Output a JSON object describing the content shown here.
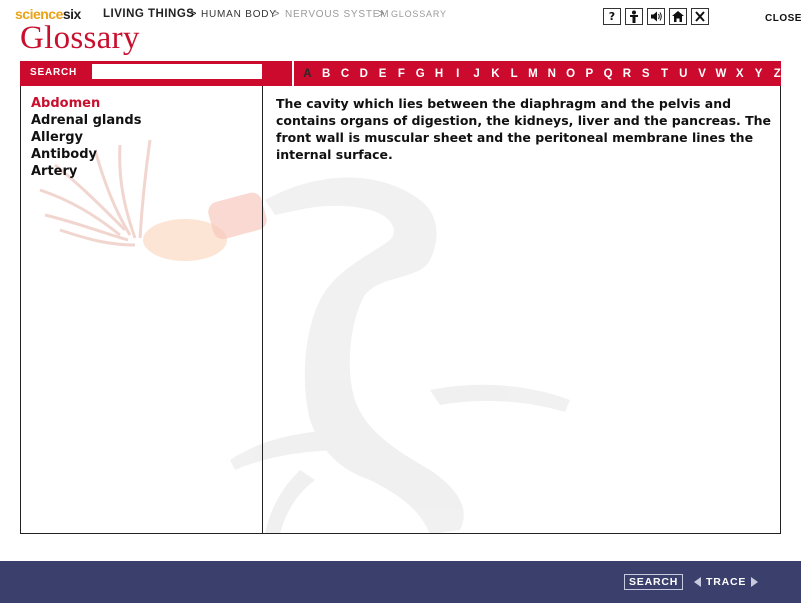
{
  "header": {
    "logo_part1": "science",
    "logo_part2": "six",
    "breadcrumb": {
      "level1": "LIVING THINGS",
      "sep1": ">",
      "level2": "HUMAN BODY",
      "sep2": ">",
      "level3": "NERVOUS SYSTEM",
      "sep3": ">",
      "level4": "GLOSSARY"
    },
    "icons": {
      "help": "?",
      "person": "person-icon",
      "sound": "speaker-icon",
      "home": "home-icon",
      "exit": "close-icon"
    },
    "close_label": "CLOSE"
  },
  "page_title": "Glossary",
  "search": {
    "label": "SEARCH",
    "value": "",
    "placeholder": ""
  },
  "alphabet": {
    "letters": [
      "A",
      "B",
      "C",
      "D",
      "E",
      "F",
      "G",
      "H",
      "I",
      "J",
      "K",
      "L",
      "M",
      "N",
      "O",
      "P",
      "Q",
      "R",
      "S",
      "T",
      "U",
      "V",
      "W",
      "X",
      "Y",
      "Z"
    ],
    "active": "A"
  },
  "terms": {
    "items": [
      {
        "label": "Abdomen",
        "selected": true
      },
      {
        "label": "Adrenal glands",
        "selected": false
      },
      {
        "label": "Allergy",
        "selected": false
      },
      {
        "label": "Antibody",
        "selected": false
      },
      {
        "label": "Artery",
        "selected": false
      }
    ]
  },
  "definition": {
    "text": "The cavity which lies between the diaphragm and the pelvis and contains organs of digestion, the kidneys, liver and the pancreas. The front wall is muscular sheet and the peritoneal membrane lines the internal surface."
  },
  "footer": {
    "search_label": "SEARCH",
    "trace_label": "TRACE"
  },
  "colors": {
    "accent": "#cc0a2d",
    "footer": "#3a3f6c",
    "selected_term": "#c8102e"
  }
}
